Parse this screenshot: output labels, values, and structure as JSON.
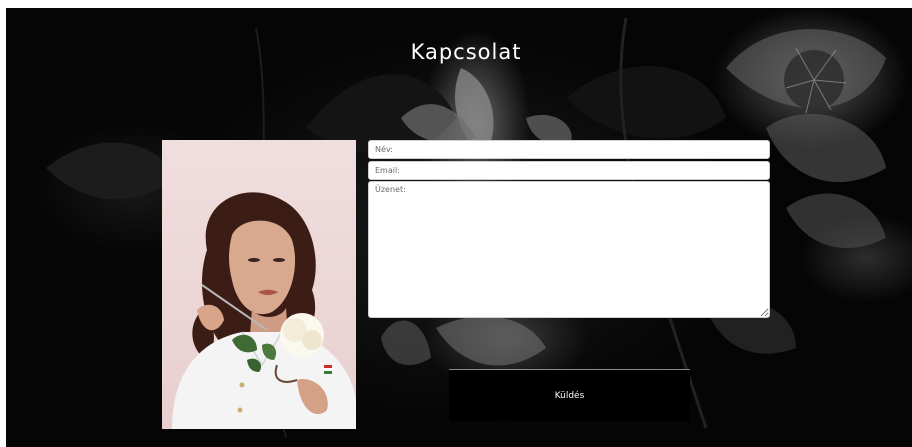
{
  "page": {
    "title": "Kapcsolat"
  },
  "form": {
    "name_placeholder": "Név:",
    "email_placeholder": "Email:",
    "message_placeholder": "Üzenet:",
    "submit_label": "Küldés"
  },
  "colors": {
    "background": "#0b0b0b",
    "title_text": "#ffffff",
    "button_bg": "#000000",
    "field_bg": "#ffffff"
  }
}
